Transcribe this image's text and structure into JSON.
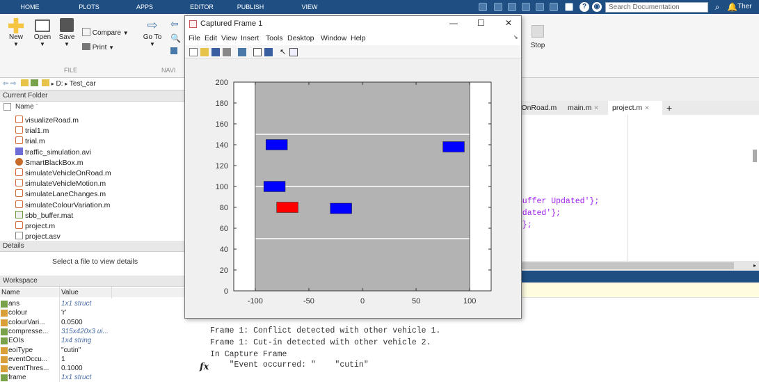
{
  "ribbon_tabs": [
    "HOME",
    "PLOTS",
    "APPS",
    "EDITOR",
    "PUBLISH",
    "VIEW"
  ],
  "search": {
    "placeholder": "Search Documentation"
  },
  "user_text": "Ther",
  "ribbon": {
    "new_label": "New",
    "open_label": "Open",
    "save_label": "Save",
    "compare_label": "Compare",
    "print_label": "Print",
    "goto_label": "Go To",
    "stop_label": "Stop",
    "file_group": "FILE",
    "nav_group": "NAVI"
  },
  "address": {
    "drive": "D:",
    "folder": "Test_car"
  },
  "current_folder": {
    "title": "Current Folder",
    "column": "Name",
    "files": [
      {
        "name": "visualizeRoad.m",
        "type": "m"
      },
      {
        "name": "trial1.m",
        "type": "m"
      },
      {
        "name": "trial.m",
        "type": "m"
      },
      {
        "name": "traffic_simulation.avi",
        "type": "avi"
      },
      {
        "name": "SmartBlackBox.m",
        "type": "box"
      },
      {
        "name": "simulateVehicleOnRoad.m",
        "type": "m"
      },
      {
        "name": "simulateVehicleMotion.m",
        "type": "m"
      },
      {
        "name": "simulateLaneChanges.m",
        "type": "m"
      },
      {
        "name": "simulateColourVariation.m",
        "type": "m"
      },
      {
        "name": "sbb_buffer.mat",
        "type": "mat"
      },
      {
        "name": "project.m",
        "type": "m"
      },
      {
        "name": "project.asv",
        "type": "asv"
      }
    ]
  },
  "details": {
    "title": "Details",
    "message": "Select a file to view details"
  },
  "workspace": {
    "title": "Workspace",
    "col_name": "Name",
    "col_value": "Value",
    "rows": [
      {
        "name": "ans",
        "value": "1x1 struct",
        "italic": true
      },
      {
        "name": "colour",
        "value": "'r'",
        "italic": false
      },
      {
        "name": "colourVari...",
        "value": "0.0500",
        "italic": false
      },
      {
        "name": "compresse...",
        "value": "315x420x3 ui...",
        "italic": true
      },
      {
        "name": "EOIs",
        "value": "1x4 string",
        "italic": true
      },
      {
        "name": "eoiType",
        "value": "\"cutin\"",
        "italic": false
      },
      {
        "name": "eventOccu...",
        "value": "1",
        "italic": false
      },
      {
        "name": "eventThres...",
        "value": "0.1000",
        "italic": false
      },
      {
        "name": "frame",
        "value": "1x1 struct",
        "italic": true
      }
    ]
  },
  "editor": {
    "tabs": [
      "cleOnRoad.m",
      "main.m",
      "project.m"
    ],
    "add_tab": "+",
    "lines": [
      " Buffer Updated'};",
      "Updated'};",
      "r'};"
    ]
  },
  "command_window": {
    "fx": "fx",
    "lines": [
      "Frame 1: Conflict detected with other vehicle 1.",
      "Frame 1: Cut-in detected with other vehicle 2.",
      "In Capture Frame",
      "    \"Event occurred: \"    \"cutin\""
    ]
  },
  "figure": {
    "title": "Captured Frame 1",
    "menu": [
      "File",
      "Edit",
      "View",
      "Insert",
      "Tools",
      "Desktop",
      "Window",
      "Help"
    ],
    "minimize": "—",
    "maximize": "☐",
    "close": "✕"
  },
  "chart_data": {
    "type": "scatter",
    "title": "",
    "xlabel": "",
    "ylabel": "",
    "xlim": [
      -120,
      120
    ],
    "ylim": [
      0,
      200
    ],
    "xticks": [
      -100,
      -50,
      0,
      50,
      100
    ],
    "yticks": [
      0,
      20,
      40,
      60,
      80,
      100,
      120,
      140,
      160,
      180,
      200
    ],
    "road": {
      "x_min": -100,
      "x_max": 100,
      "color": "#b3b3b3"
    },
    "lane_lines": [
      50,
      100,
      150
    ],
    "vehicles": [
      {
        "x": -80,
        "y": 140,
        "w": 20,
        "h": 10,
        "color": "#0000ff"
      },
      {
        "x": 85,
        "y": 138,
        "w": 20,
        "h": 10,
        "color": "#0000ff"
      },
      {
        "x": -82,
        "y": 100,
        "w": 20,
        "h": 10,
        "color": "#0000ff"
      },
      {
        "x": -70,
        "y": 80,
        "w": 20,
        "h": 10,
        "color": "#ff0000"
      },
      {
        "x": -20,
        "y": 79,
        "w": 20,
        "h": 10,
        "color": "#0000ff"
      }
    ]
  }
}
